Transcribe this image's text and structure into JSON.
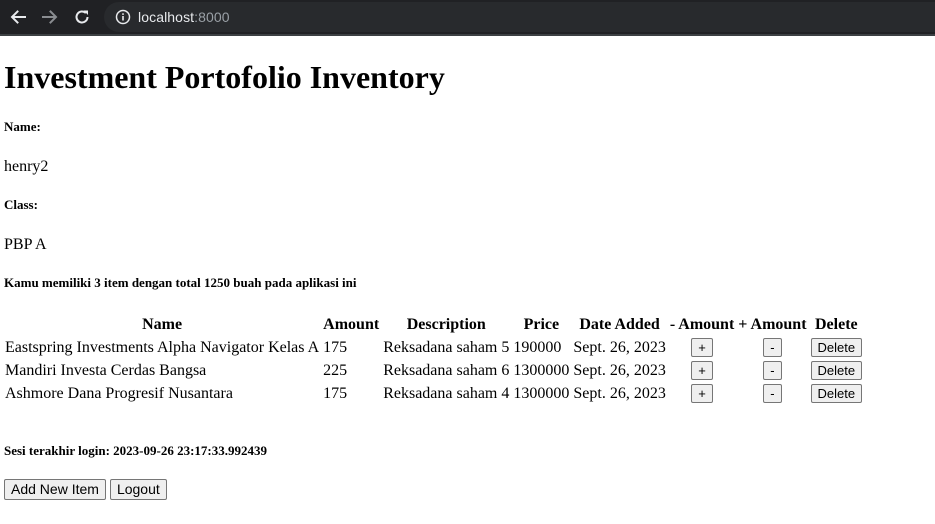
{
  "browser": {
    "url_host": "localhost",
    "url_port": ":8000",
    "icons": [
      "back-icon",
      "forward-icon",
      "reload-icon",
      "info-icon"
    ]
  },
  "page": {
    "title": "Investment Portofolio Inventory",
    "name_label": "Name:",
    "name_value": "henry2",
    "class_label": "Class:",
    "class_value": "PBP A",
    "summary": "Kamu memiliki 3 item dengan total 1250 buah pada aplikasi ini",
    "last_login": "Sesi terakhir login: 2023-09-26 23:17:33.992439",
    "add_button": "Add New Item",
    "logout_button": "Logout"
  },
  "table": {
    "headers": [
      "Name",
      "Amount",
      "Description",
      "Price",
      "Date Added",
      "- Amount",
      "+ Amount",
      "Delete"
    ],
    "rows": [
      {
        "name": "Eastspring Investments Alpha Navigator Kelas A",
        "amount": "175",
        "description": "Reksadana saham 5",
        "price": "190000",
        "date_added": "Sept. 26, 2023",
        "minus_btn": "+",
        "plus_btn": "-",
        "delete_btn": "Delete"
      },
      {
        "name": "Mandiri Investa Cerdas Bangsa",
        "amount": "225",
        "description": "Reksadana saham 6",
        "price": "1300000",
        "date_added": "Sept. 26, 2023",
        "minus_btn": "+",
        "plus_btn": "-",
        "delete_btn": "Delete"
      },
      {
        "name": "Ashmore Dana Progresif Nusantara",
        "amount": "175",
        "description": "Reksadana saham 4",
        "price": "1300000",
        "date_added": "Sept. 26, 2023",
        "minus_btn": "+",
        "plus_btn": "-",
        "delete_btn": "Delete"
      }
    ]
  }
}
